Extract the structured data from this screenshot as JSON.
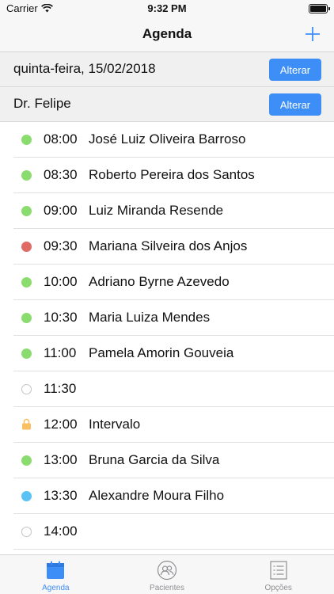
{
  "status": {
    "carrier": "Carrier",
    "time": "9:32 PM"
  },
  "nav": {
    "title": "Agenda",
    "add_icon": "plus-icon"
  },
  "date_row": {
    "label": "quinta-feira, 15/02/2018",
    "button": "Alterar"
  },
  "doctor_row": {
    "label": "Dr. Felipe",
    "button": "Alterar"
  },
  "colors": {
    "green": "#8bdc6e",
    "red": "#e06a64",
    "blue": "#5ac2f5",
    "accent": "#3e8ef7",
    "lock": "#f9bf60"
  },
  "appointments": [
    {
      "time": "08:00",
      "name": "José Luiz Oliveira Barroso",
      "status": "green"
    },
    {
      "time": "08:30",
      "name": "Roberto Pereira dos Santos",
      "status": "green"
    },
    {
      "time": "09:00",
      "name": "Luiz Miranda Resende",
      "status": "green"
    },
    {
      "time": "09:30",
      "name": "Mariana Silveira dos Anjos",
      "status": "red"
    },
    {
      "time": "10:00",
      "name": "Adriano Byrne Azevedo",
      "status": "green"
    },
    {
      "time": "10:30",
      "name": "Maria Luiza Mendes",
      "status": "green"
    },
    {
      "time": "11:00",
      "name": "Pamela Amorin Gouveia",
      "status": "green"
    },
    {
      "time": "11:30",
      "name": "",
      "status": "empty"
    },
    {
      "time": "12:00",
      "name": "Intervalo",
      "status": "lock"
    },
    {
      "time": "13:00",
      "name": "Bruna Garcia da Silva",
      "status": "green"
    },
    {
      "time": "13:30",
      "name": "Alexandre Moura Filho",
      "status": "blue"
    },
    {
      "time": "14:00",
      "name": "",
      "status": "empty"
    }
  ],
  "tabs": [
    {
      "label": "Agenda",
      "icon": "calendar-icon",
      "active": true
    },
    {
      "label": "Pacientes",
      "icon": "patients-icon",
      "active": false
    },
    {
      "label": "Opções",
      "icon": "list-icon",
      "active": false
    }
  ]
}
